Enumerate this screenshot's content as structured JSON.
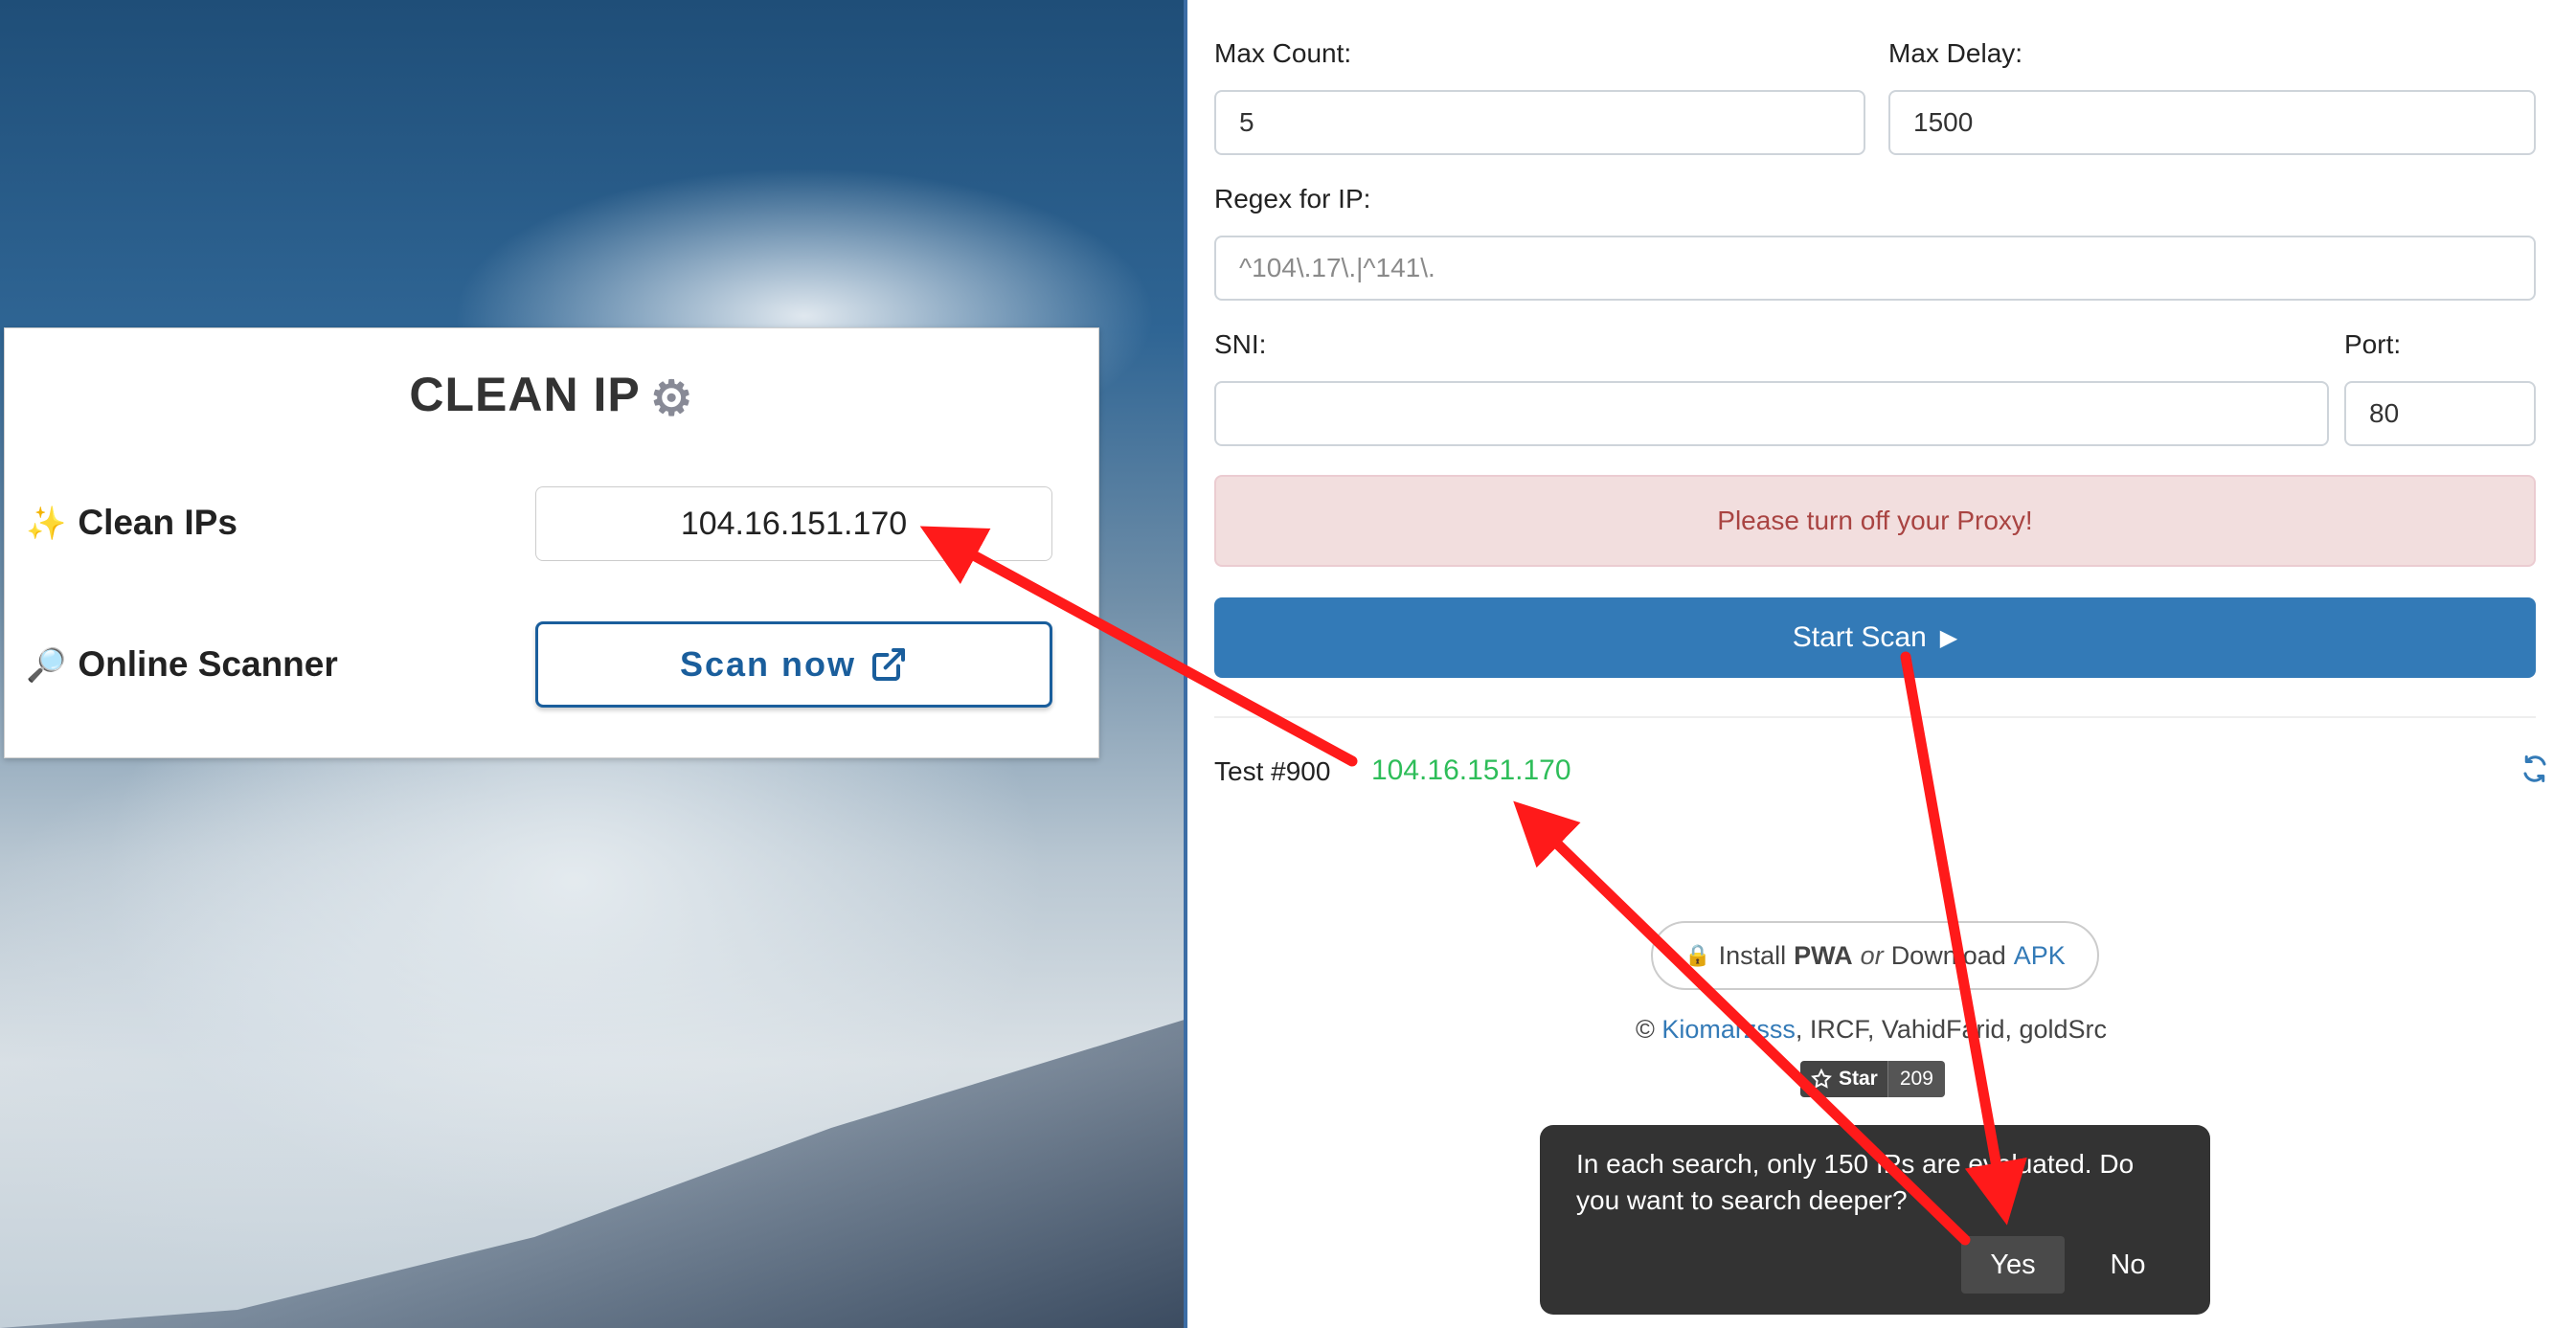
{
  "card": {
    "title": "CLEAN IP",
    "gear_icon": "⚙",
    "clean_ips_emoji": "✨",
    "clean_ips_label": "Clean IPs",
    "clean_ip_value": "104.16.151.170",
    "scanner_emoji": "🔎",
    "scanner_label": "Online Scanner",
    "scan_button": "Scan now",
    "scan_button_icon": "external-link-icon"
  },
  "form": {
    "max_count_label": "Max Count:",
    "max_count_value": "5",
    "max_delay_label": "Max Delay:",
    "max_delay_value": "1500",
    "regex_label": "Regex for IP:",
    "regex_placeholder": "^104\\.17\\.|^141\\.",
    "sni_label": "SNI:",
    "sni_value": "",
    "port_label": "Port:",
    "port_value": "80"
  },
  "alert": {
    "text": "Please turn off your Proxy!"
  },
  "start_button": {
    "label": "Start Scan",
    "icon": "▶"
  },
  "result": {
    "test_label": "Test #900",
    "ip": "104.16.151.170",
    "refresh_icon": "refresh-icon"
  },
  "footer": {
    "lock_emoji": "🔒",
    "install_text": "Install",
    "pwa": "PWA",
    "or": "or",
    "download_text": "Download",
    "apk": "APK",
    "copyright": "©",
    "author_link": "Kiomarzsss",
    "other_authors": ", IRCF, VahidFarid, goldSrc",
    "star_label": "Star",
    "star_count": "209"
  },
  "dialog": {
    "message": "In each search, only 150 IPs are evaluated. Do you want to search deeper?",
    "yes": "Yes",
    "no": "No"
  },
  "colors": {
    "primary": "#337ab7",
    "alert_bg": "#f2dede",
    "alert_text": "#a94442",
    "success": "#2ebd59",
    "annotation": "#ff1a1a",
    "dialog_bg": "#333333"
  }
}
